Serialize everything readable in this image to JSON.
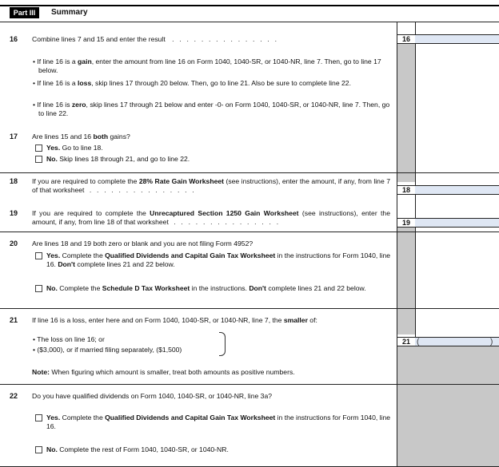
{
  "header": {
    "part": "Part III",
    "title": "Summary"
  },
  "line16": {
    "num": "16",
    "text": "Combine lines 7 and 15 and enter the result",
    "box": "16",
    "bullet_gain_1": "If line 16 is a ",
    "bullet_gain_bold": "gain",
    "bullet_gain_2": ", enter the amount from line 16 on Form 1040, 1040-SR, or 1040-NR, line 7. Then, go to line 17 below.",
    "bullet_loss_1": "If line 16 is a ",
    "bullet_loss_bold": "loss",
    "bullet_loss_2": ", skip lines 17 through 20 below. Then, go to line 21. Also be sure to complete line 22.",
    "bullet_zero_1": "If line 16 is ",
    "bullet_zero_bold": "zero",
    "bullet_zero_2": ", skip lines 17 through 21 below and enter -0- on Form 1040, 1040-SR, or 1040-NR, line 7. Then, go to line 22."
  },
  "line17": {
    "num": "17",
    "q_1": "Are lines 15 and 16 ",
    "q_bold": "both",
    "q_2": " gains?",
    "yes_bold": "Yes.",
    "yes_text": " Go to line 18.",
    "no_bold": "No.",
    "no_text": " Skip lines 18 through 21, and go to line 22."
  },
  "line18": {
    "num": "18",
    "text_1": "If you are required to complete the ",
    "text_bold": "28% Rate Gain Worksheet",
    "text_2": " (see instructions), enter the amount, if any, from line 7 of that worksheet",
    "box": "18"
  },
  "line19": {
    "num": "19",
    "text_1": "If you are required to complete the ",
    "text_bold": "Unrecaptured Section 1250 Gain Worksheet",
    "text_2": " (see instructions), enter the amount, if any, from line 18 of that worksheet",
    "box": "19"
  },
  "line20": {
    "num": "20",
    "q": "Are lines 18 and 19 both zero or blank and you are not filing Form 4952?",
    "yes_bold": "Yes.",
    "yes_text_1": " Complete the ",
    "yes_text_bold": "Qualified Dividends and Capital Gain Tax Worksheet",
    "yes_text_2": " in the instructions for Form 1040, line 16. ",
    "yes_text_bold2": "Don't",
    "yes_text_3": " complete lines 21 and 22 below.",
    "no_bold": "No.",
    "no_text_1": " Complete the ",
    "no_text_bold": "Schedule D Tax Worksheet",
    "no_text_2": " in the instructions. ",
    "no_text_bold2": "Don't",
    "no_text_3": " complete lines 21 and 22 below."
  },
  "line21": {
    "num": "21",
    "text_1": "If line 16 is a loss, enter here and on Form 1040, 1040-SR, or 1040-NR, line 7, the ",
    "text_bold": "smaller",
    "text_2": " of:",
    "bullet_a": "The loss on line 16; or",
    "bullet_b": "($3,000), or if married filing separately, ($1,500)",
    "box": "21",
    "paren_open": "(",
    "paren_close": ")",
    "note_bold": "Note:",
    "note_text": " When figuring which amount is smaller, treat both amounts as positive numbers."
  },
  "line22": {
    "num": "22",
    "q": "Do you have qualified dividends on Form 1040, 1040-SR, or 1040-NR, line 3a?",
    "yes_bold": "Yes.",
    "yes_text_1": " Complete the ",
    "yes_text_bold": "Qualified Dividends and Capital Gain Tax Worksheet",
    "yes_text_2": " in the instructions for Form 1040, line 16.",
    "no_bold": "No.",
    "no_text": " Complete the rest of Form 1040, 1040-SR, or 1040-NR."
  },
  "leader_dots": ". . . . . . . . . . . . . . .",
  "leader_dots_short": ". . . . . . . . . . . . . . . . . . . . . . . . ."
}
